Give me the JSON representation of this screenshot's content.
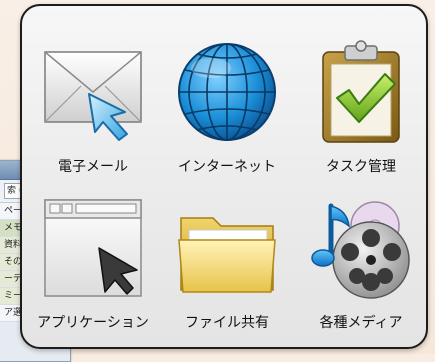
{
  "background_window": {
    "search_text": "索 (C",
    "rows": [
      "ページ",
      "メモ",
      "資料",
      "その",
      "ーディ",
      "ミー",
      "ア選定"
    ]
  },
  "launcher": {
    "items": [
      {
        "label": "電子メール",
        "icon": "envelope-icon"
      },
      {
        "label": "インターネット",
        "icon": "globe-icon"
      },
      {
        "label": "タスク管理",
        "icon": "clipboard-check-icon"
      },
      {
        "label": "アプリケーション",
        "icon": "application-window-icon"
      },
      {
        "label": "ファイル共有",
        "icon": "folder-icon"
      },
      {
        "label": "各種メディア",
        "icon": "media-icon"
      }
    ]
  }
}
